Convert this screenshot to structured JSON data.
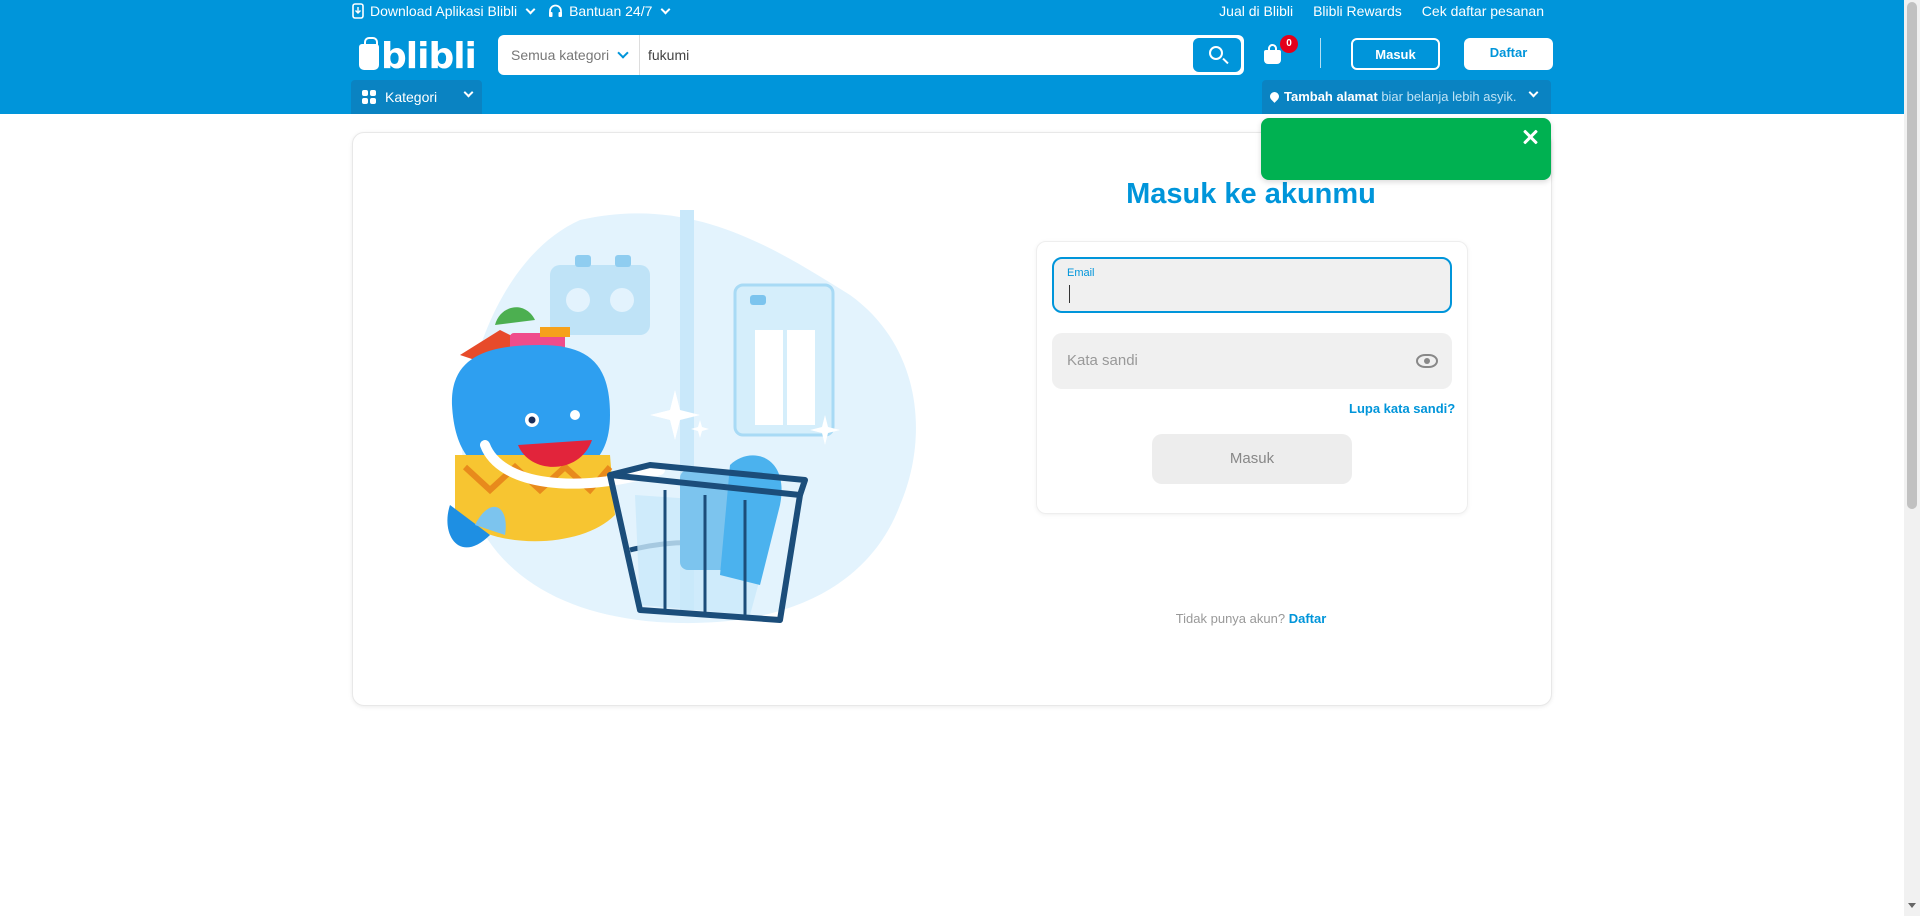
{
  "topbar": {
    "download_app": "Download Aplikasi Blibli",
    "support": "Bantuan 24/7",
    "links": [
      "Jual di Blibli",
      "Blibli Rewards",
      "Cek daftar pesanan"
    ]
  },
  "header": {
    "logo": "blibli",
    "category_select": "Semua kategori",
    "search_value": "fukumi",
    "cart_count": "0",
    "login_label": "Masuk",
    "register_label": "Daftar",
    "category_menu": "Kategori",
    "address_bold": "Tambah alamat",
    "address_hint": "biar belanja lebih asyik."
  },
  "login": {
    "title": "Masuk ke akunmu",
    "email_label": "Email",
    "password_placeholder": "Kata sandi",
    "forgot": "Lupa kata sandi?",
    "submit": "Masuk",
    "no_account": "Tidak punya akun?",
    "register_link": "Daftar"
  },
  "colors": {
    "brand": "#0095da",
    "toast": "#00b151",
    "badge": "#e4001b"
  },
  "icons": [
    "phone-download-icon",
    "headset-icon",
    "search-icon",
    "cart-icon",
    "grid-icon",
    "pin-icon",
    "eye-icon",
    "close-icon"
  ]
}
